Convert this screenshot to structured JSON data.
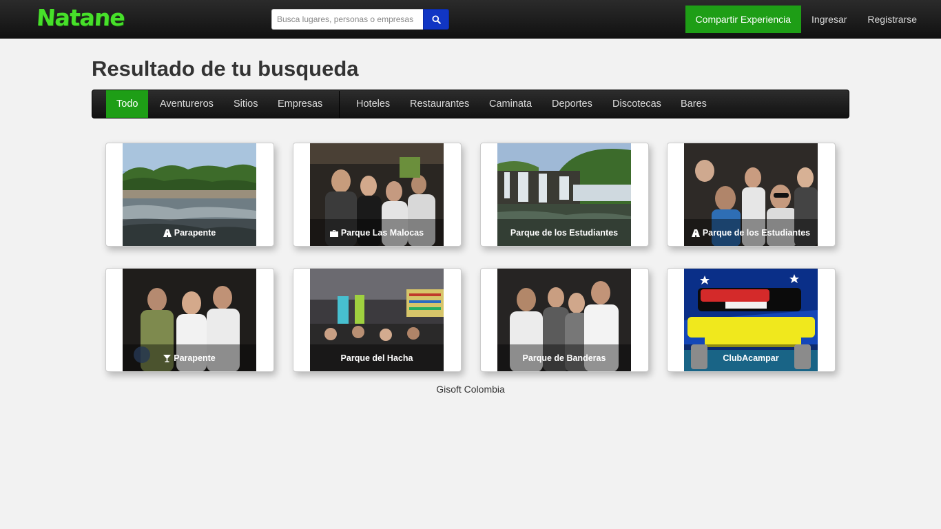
{
  "header": {
    "logo": "Natane",
    "search_placeholder": "Busca lugares, personas o empresas",
    "share_label": "Compartir Experiencia",
    "login_label": "Ingresar",
    "register_label": "Registrarse"
  },
  "page": {
    "title": "Resultado de tu busqueda"
  },
  "filters": [
    {
      "label": "Todo"
    },
    {
      "label": "Aventureros"
    },
    {
      "label": "Sitios"
    },
    {
      "label": "Empresas"
    },
    {
      "label": "Hoteles"
    },
    {
      "label": "Restaurantes"
    },
    {
      "label": "Caminata"
    },
    {
      "label": "Deportes"
    },
    {
      "label": "Discotecas"
    },
    {
      "label": "Bares"
    }
  ],
  "results": [
    {
      "title": "Parapente",
      "icon": "road-icon"
    },
    {
      "title": "Parque Las Malocas",
      "icon": "suitcase-icon"
    },
    {
      "title": "Parque de los Estudiantes",
      "icon": ""
    },
    {
      "title": "Parque de los Estudiantes",
      "icon": "road-icon"
    },
    {
      "title": "Parapente",
      "icon": "cocktail-icon"
    },
    {
      "title": "Parque del Hacha",
      "icon": ""
    },
    {
      "title": "Parque de Banderas",
      "icon": ""
    },
    {
      "title": "ClubAcampar",
      "icon": ""
    }
  ],
  "footer": {
    "text": "Gisoft Colombia"
  },
  "colors": {
    "accent_green": "#1e9e16",
    "search_blue": "#1136c4",
    "logo_green": "#47e02a"
  }
}
